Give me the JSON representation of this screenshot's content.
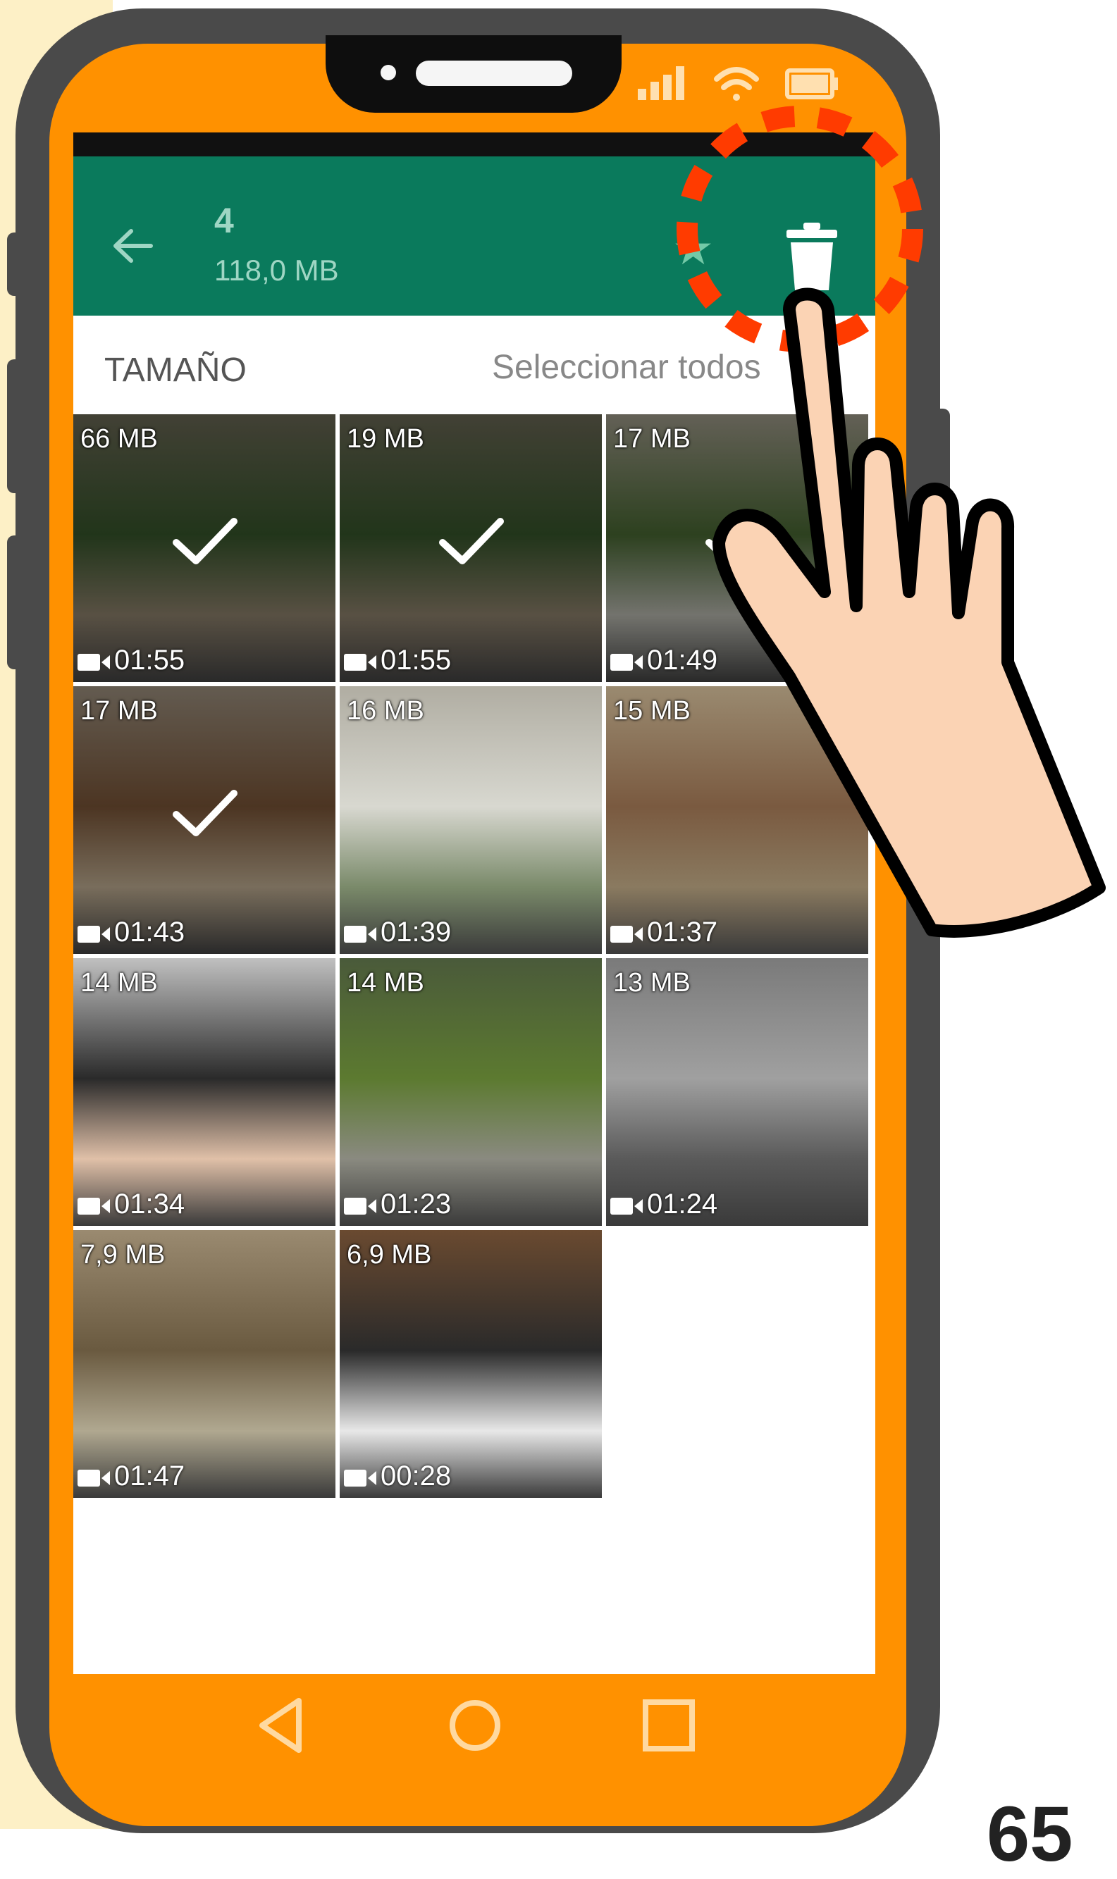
{
  "status_bar": {
    "icons": [
      "signal-icon",
      "wifi-icon",
      "battery-icon"
    ]
  },
  "header": {
    "selected_count": "4",
    "selected_size": "118,0 MB",
    "icons": [
      "back-arrow-icon",
      "star-icon",
      "trash-icon"
    ],
    "colors": {
      "bar": "#0a7a5c",
      "text": "#9fd6c4"
    }
  },
  "subheader": {
    "sort_label": "TAMAÑO",
    "select_all_label": "Seleccionar todos"
  },
  "videos": [
    {
      "size": "66 MB",
      "duration": "01:55",
      "selected": true
    },
    {
      "size": "19 MB",
      "duration": "01:55",
      "selected": true
    },
    {
      "size": "17 MB",
      "duration": "01:49",
      "selected": true
    },
    {
      "size": "17 MB",
      "duration": "01:43",
      "selected": true
    },
    {
      "size": "16 MB",
      "duration": "01:39",
      "selected": false
    },
    {
      "size": "15 MB",
      "duration": "01:37",
      "selected": false
    },
    {
      "size": "14 MB",
      "duration": "01:34",
      "selected": false
    },
    {
      "size": "14 MB",
      "duration": "01:23",
      "selected": false
    },
    {
      "size": "13 MB",
      "duration": "01:24",
      "selected": false
    },
    {
      "size": "7,9 MB",
      "duration": "01:47",
      "selected": false
    },
    {
      "size": "6,9 MB",
      "duration": "00:28",
      "selected": false
    }
  ],
  "nav": {
    "icons": [
      "back-triangle-icon",
      "home-circle-icon",
      "recents-square-icon"
    ]
  },
  "overlay": {
    "icons": [
      "pointing-hand-icon",
      "highlight-dashed-circle"
    ],
    "highlight_color": "#ff3b00"
  },
  "frame_colors": {
    "phone_body": "#4a4a4a",
    "phone_face": "#ff9100",
    "side_strip": "#fdf0c6"
  },
  "page_number": "65"
}
